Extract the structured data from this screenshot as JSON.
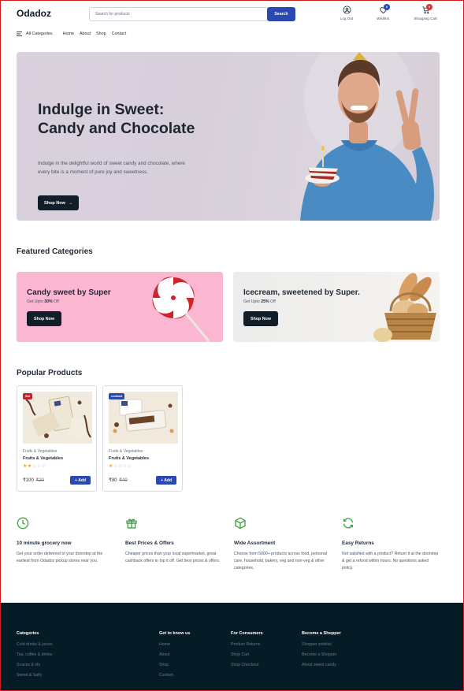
{
  "header": {
    "brand": "Odadoz",
    "search_placeholder": "Search for products",
    "search_button": "Search",
    "actions": [
      {
        "label": "Log Out",
        "icon": "user-icon"
      },
      {
        "label": "Wishlist",
        "icon": "heart-icon",
        "badge": "0"
      },
      {
        "label": "Shopping Cart",
        "icon": "cart-icon",
        "badge": "0"
      }
    ]
  },
  "nav": {
    "all_categories": "All Categories",
    "links": [
      "Home",
      "About",
      "Shop",
      "Contact"
    ]
  },
  "hero": {
    "title": "Indulge in Sweet: Candy and Chocolate",
    "description": "Indulge in the delightful world of sweet candy and chocolate, where every bite is a moment of pure joy and sweetness.",
    "button": "Shop Now"
  },
  "featured": {
    "title": "Featured Categories",
    "cards": [
      {
        "title": "Candy sweet by Super",
        "subtitle_prefix": "Get Upto ",
        "discount": "30%",
        "subtitle_suffix": " Off",
        "button": "Shop Now"
      },
      {
        "title": "Icecream, sweetened by Super.",
        "subtitle_prefix": "Get Upto ",
        "discount": "25%",
        "subtitle_suffix": " Off",
        "button": "Shop Now"
      }
    ]
  },
  "popular": {
    "title": "Popular Products",
    "products": [
      {
        "tag": "Sal",
        "category": "Fruits & Vegetables",
        "name": "Fruits & Vegetables",
        "price": "₹100",
        "old_price": "₹20",
        "rating": 2,
        "add": "Add"
      },
      {
        "tag": "contact",
        "category": "Fruits & Vegetables",
        "name": "Fruits & Vegetables",
        "price": "₹80",
        "old_price": "₹40",
        "rating": 1,
        "add": "Add"
      }
    ]
  },
  "features": [
    {
      "title": "10 minute grocery now",
      "desc": "Get your order delivered to your doorstep at the earliest from Odadoz pickup stores near you.",
      "icon": "clock-icon"
    },
    {
      "title": "Best Prices & Offers",
      "desc": "Cheaper prices than your local supermarket, great cashback offers to top it off. Get best prices & offers.",
      "icon": "gift-icon"
    },
    {
      "title": "Wide Assortment",
      "desc": "Choose from 5000+ products across food, personal care, household, bakery, veg and non-veg & other categories.",
      "icon": "box-icon"
    },
    {
      "title": "Easy Returns",
      "desc": "Not satisfied with a product? Return it at the doorstep & get a refund within hours. No questions asked policy.",
      "icon": "refresh-icon"
    }
  ],
  "footer": {
    "columns": [
      {
        "heading": "Categories",
        "links": [
          "Cold drinks & juices",
          "Tea, coffee & drinks",
          "Snacks & sfx",
          "Sweet & Salty"
        ]
      },
      {
        "heading": "Get to know us",
        "links": [
          "Home",
          "About",
          "Shop",
          "Contact"
        ]
      },
      {
        "heading": "For Consumers",
        "links": [
          "Product Returns",
          "Shop Cart",
          "Shop Checkout"
        ]
      },
      {
        "heading": "Become a Shopper",
        "links": [
          "Shopper wishlist",
          "Become a Shopper",
          "About sweet candy"
        ]
      }
    ]
  },
  "colors": {
    "primary": "#2b48b0",
    "dark": "#0f1e28",
    "footer_bg": "#051b26",
    "feature_green": "#3fa33f",
    "sale_red": "#c0262d",
    "star": "#f59e0b",
    "pink_card": "#fbb6d2"
  }
}
